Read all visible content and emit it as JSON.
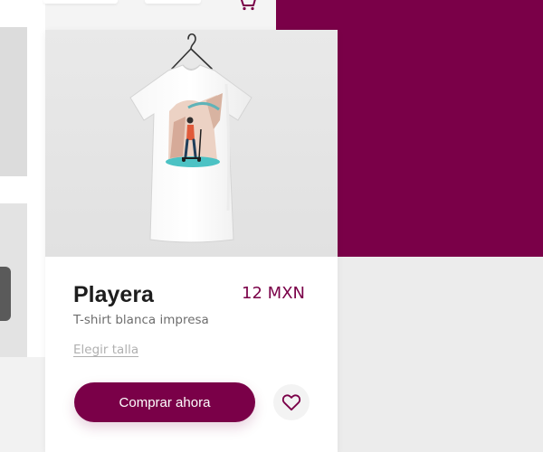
{
  "product": {
    "name": "Playera",
    "price": "12 MXN",
    "description": "T-shirt blanca impresa",
    "size_link": "Elegir talla"
  },
  "actions": {
    "buy_label": "Comprar ahora"
  },
  "colors": {
    "brand": "#7a0048",
    "card": "#ffffff",
    "photo_bg": "#e4e4e4"
  },
  "icons": {
    "cart": "cart-icon",
    "favorite": "heart-icon"
  }
}
